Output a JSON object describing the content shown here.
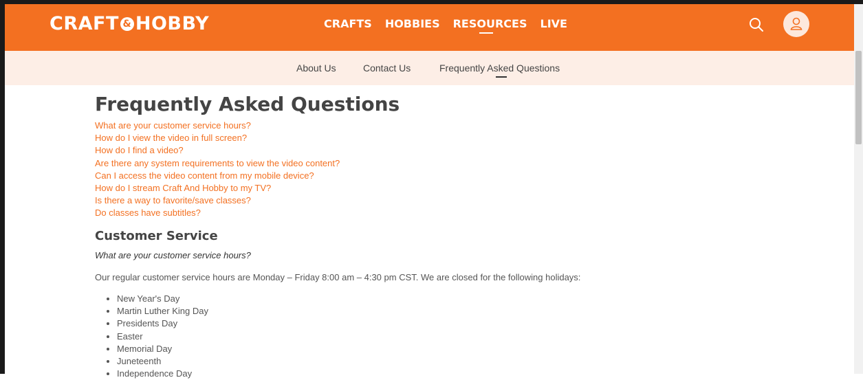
{
  "header": {
    "logo_left": "CRAFT",
    "logo_amp": "&",
    "logo_right": "HOBBY",
    "nav": [
      "CRAFTS",
      "HOBBIES",
      "RESOURCES",
      "LIVE"
    ],
    "active_nav": "RESOURCES"
  },
  "subnav": {
    "items": [
      "About Us",
      "Contact Us",
      "Frequently Asked Questions"
    ],
    "active": "Frequently Asked Questions"
  },
  "page": {
    "title": "Frequently Asked Questions",
    "faq_links": [
      "What are your customer service hours?",
      "How do I view the video in full screen?",
      "How do I find a video?",
      "Are there any system requirements to view the video content?",
      "Can I access the video content from my mobile device?",
      "How do I stream Craft And Hobby to my TV?",
      "Is there a way to favorite/save classes?",
      "Do classes have subtitles?"
    ],
    "section_title": "Customer Service",
    "question": "What are your customer service hours?",
    "answer": "Our regular customer service hours are Monday – Friday 8:00 am – 4:30 pm CST. We are closed for the following holidays:",
    "holidays": [
      "New Year's Day",
      "Martin Luther King Day",
      "Presidents Day",
      "Easter",
      "Memorial Day",
      "Juneteenth",
      "Independence Day"
    ]
  },
  "colors": {
    "brand": "#f37021",
    "subnav_bg": "#fdeee6"
  }
}
